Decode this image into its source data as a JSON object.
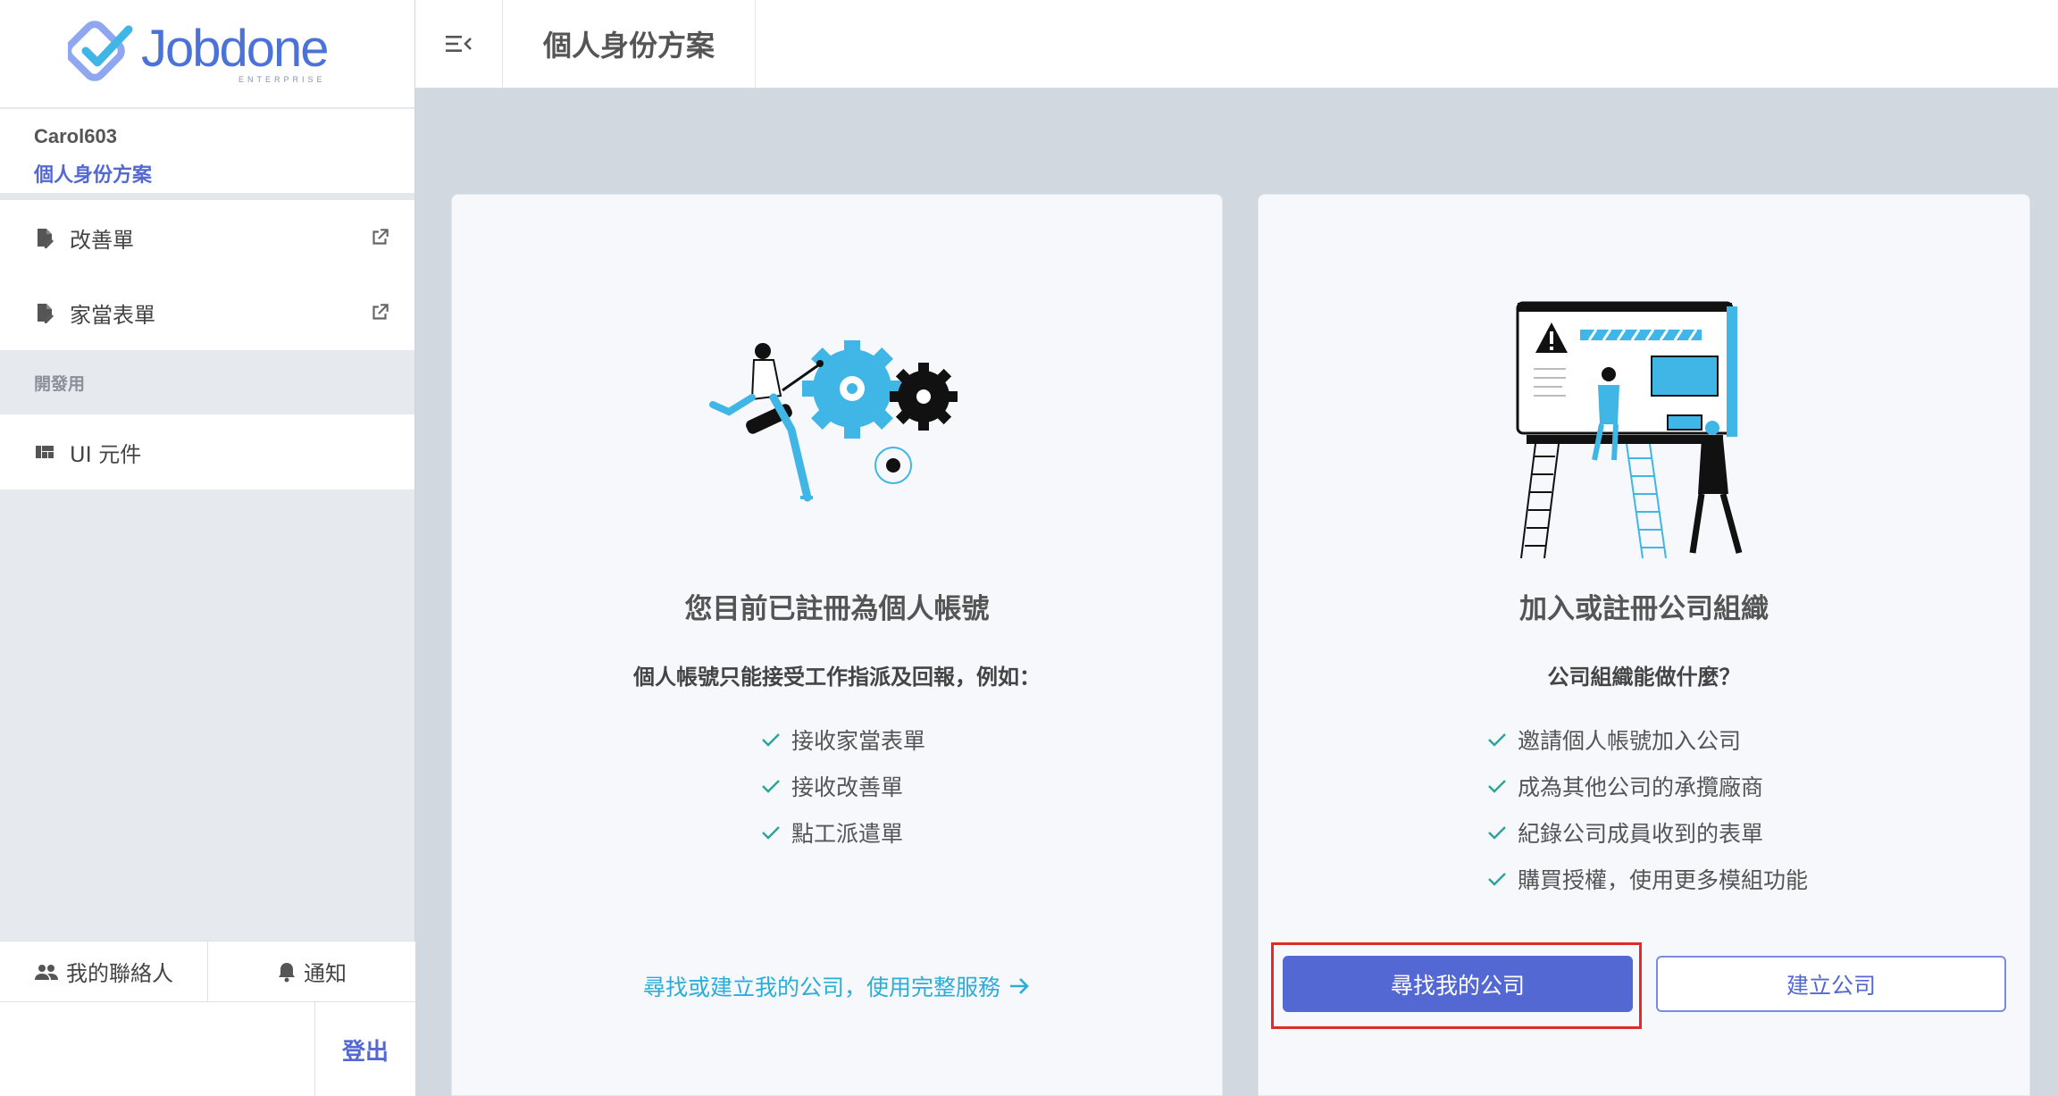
{
  "brand": {
    "name": "Jobdone",
    "tagline": "ENTERPRISE",
    "accent": "#5468d4",
    "teal": "#2aaed8"
  },
  "sidebar": {
    "username": "Carol603",
    "plan": "個人身份方案",
    "items": [
      {
        "label": "改善單",
        "icon": "document-edit-icon"
      },
      {
        "label": "家當表單",
        "icon": "document-edit-icon"
      }
    ],
    "dev_section": "開發用",
    "dev_items": [
      {
        "label": "UI 元件",
        "icon": "dashboard-icon"
      }
    ],
    "footer": {
      "contacts": "我的聯絡人",
      "notifications": "通知",
      "logout": "登出"
    }
  },
  "header": {
    "title": "個人身份方案"
  },
  "cards": {
    "personal": {
      "title": "您目前已註冊為個人帳號",
      "subtitle": "個人帳號只能接受工作指派及回報，例如：",
      "features": [
        "接收家當表單",
        "接收改善單",
        "點工派遣單"
      ],
      "link": "尋找或建立我的公司，使用完整服務"
    },
    "company": {
      "title": "加入或註冊公司組織",
      "subtitle": "公司組織能做什麼？",
      "features": [
        "邀請個人帳號加入公司",
        "成為其他公司的承攬廠商",
        "紀錄公司成員收到的表單",
        "購買授權，使用更多模組功能"
      ],
      "find_button": "尋找我的公司",
      "create_button": "建立公司"
    }
  }
}
